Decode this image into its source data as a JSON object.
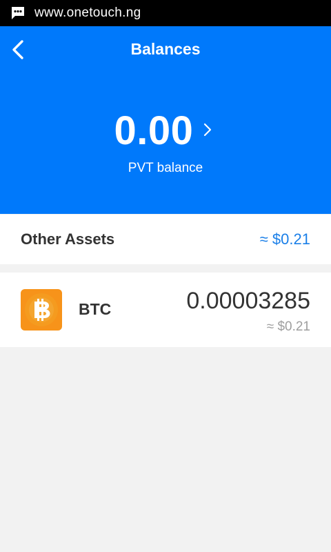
{
  "statusbar": {
    "url": "www.onetouch.ng",
    "icon": "message-icon"
  },
  "header": {
    "title": "Balances",
    "back_icon": "chevron-left-icon"
  },
  "balance": {
    "value": "0.00",
    "label": "PVT balance",
    "more_icon": "chevron-right-icon"
  },
  "other_assets": {
    "label": "Other Assets",
    "total": "≈ $0.21"
  },
  "assets": [
    {
      "symbol": "BTC",
      "amount": "0.00003285",
      "fiat": "≈ $0.21",
      "icon": "bitcoin-icon",
      "color": "#f7931a"
    }
  ],
  "colors": {
    "primary": "#0079fb",
    "accent_text": "#1a7fe8",
    "background": "#f2f2f2"
  }
}
